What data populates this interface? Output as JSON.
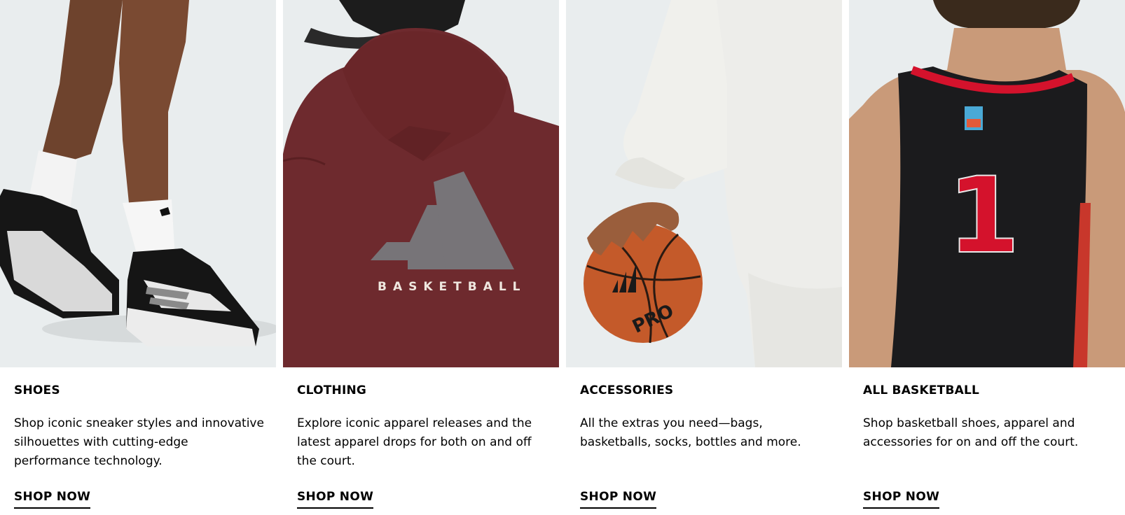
{
  "cards": [
    {
      "title": "SHOES",
      "description": "Shop iconic sneaker styles and innovative silhouettes with cutting-edge performance technology.",
      "cta": "SHOP NOW",
      "image_subject": "shoes-photo",
      "colors": {
        "background": "#e9edee",
        "skin": "#7a4a32",
        "sock": "#f4f4f4",
        "shoe_black": "#151515"
      }
    },
    {
      "title": "CLOTHING",
      "description": "Explore iconic apparel releases and the latest apparel drops for both on and off the court.",
      "cta": "SHOP NOW",
      "image_subject": "hoodie-photo",
      "image_text": "BASKETBALL",
      "colors": {
        "background": "#e9edee",
        "hoodie": "#6e2a2e",
        "logo": "#777478"
      }
    },
    {
      "title": "ACCESSORIES",
      "description": "All the extras you need—bags, basketballs, socks, bottles and more.",
      "cta": "SHOP NOW",
      "image_subject": "basketball-photo",
      "image_text": "PRO",
      "colors": {
        "background": "#e9edee",
        "sweatshirt": "#ededea",
        "ball": "#c45a2a"
      }
    },
    {
      "title": "ALL BASKETBALL",
      "description": "Shop basketball shoes, apparel and accessories for on and off the court.",
      "cta": "SHOP NOW",
      "image_subject": "jersey-photo",
      "image_text": "1",
      "colors": {
        "background": "#e9edee",
        "jersey": "#1b1b1d",
        "trim": "#d4122c",
        "skin": "#c99a79"
      }
    }
  ]
}
